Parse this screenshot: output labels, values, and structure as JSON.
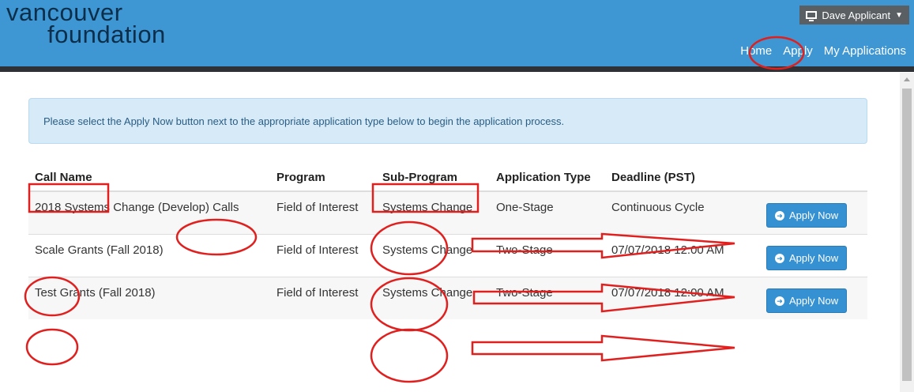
{
  "header": {
    "logo_line1": "vancouver",
    "logo_line2": "foundation",
    "user_label": "Dave Applicant",
    "nav": [
      "Home",
      "Apply",
      "My Applications"
    ]
  },
  "notice": "Please select the Apply Now button next to the appropriate application type below to begin the application process.",
  "table": {
    "headers": [
      "Call Name",
      "Program",
      "Sub-Program",
      "Application Type",
      "Deadline (PST)"
    ],
    "rows": [
      {
        "call_name": "2018 Systems Change (Develop) Calls",
        "program": "Field of Interest",
        "sub_program": "Systems Change",
        "type": "One-Stage",
        "deadline": "Continuous Cycle",
        "action": "Apply Now"
      },
      {
        "call_name": "Scale Grants (Fall 2018)",
        "program": "Field of Interest",
        "sub_program": "Systems Change",
        "type": "Two-Stage",
        "deadline": "07/07/2018 12:00 AM",
        "action": "Apply Now"
      },
      {
        "call_name": "Test Grants (Fall 2018)",
        "program": "Field of Interest",
        "sub_program": "Systems Change",
        "type": "Two-Stage",
        "deadline": "07/07/2018 12:00 AM",
        "action": "Apply Now"
      }
    ]
  },
  "colors": {
    "header_bar": "#3e97d3",
    "button": "#3591d1",
    "annotation": "#e0201f"
  }
}
